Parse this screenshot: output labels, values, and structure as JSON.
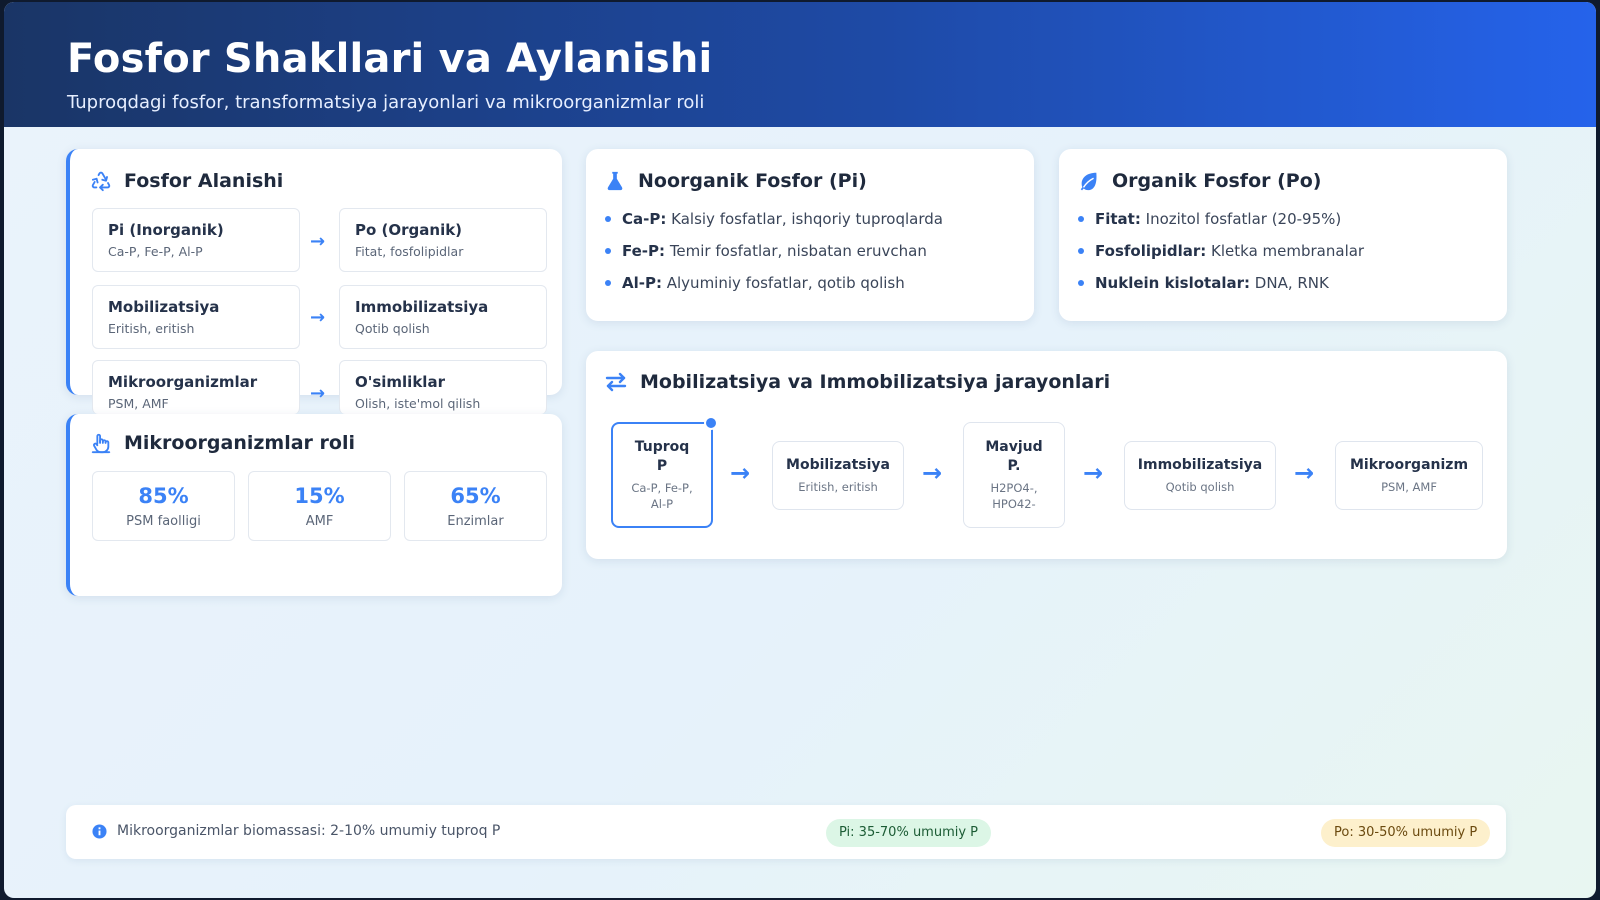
{
  "header": {
    "title": "Fosfor Shakllari va Aylanishi",
    "subtitle": "Tuproqdagi fosfor, transformatsiya jarayonlari va mikroorganizmlar roli"
  },
  "exchange": {
    "title": "Fosfor Alanishi",
    "icon": "recycle-icon",
    "rows": [
      {
        "left_title": "Pi (Inorganik)",
        "left_sub": "Ca-P, Fe-P, Al-P",
        "right_title": "Po (Organik)",
        "right_sub": "Fitat, fosfolipidlar"
      },
      {
        "left_title": "Mobilizatsiya",
        "left_sub": "Eritish, eritish",
        "right_title": "Immobilizatsiya",
        "right_sub": "Qotib qolish"
      },
      {
        "left_title": "Mikroorganizmlar",
        "left_sub": "PSM, AMF",
        "right_title": "O'simliklar",
        "right_sub": "Olish, iste'mol qilish"
      }
    ]
  },
  "microbes": {
    "title": "Mikroorganizmlar roli",
    "icon": "hand-icon",
    "stats": [
      {
        "value": "85%",
        "label": "PSM faolligi"
      },
      {
        "value": "15%",
        "label": "AMF"
      },
      {
        "value": "65%",
        "label": "Enzimlar"
      }
    ]
  },
  "inorganic": {
    "title": "Noorganik Fosfor (Pi)",
    "icon": "flask-icon",
    "items": [
      {
        "term": "Ca-P:",
        "desc": "Kalsiy fosfatlar, ishqoriy tuproqlarda"
      },
      {
        "term": "Fe-P:",
        "desc": "Temir fosfatlar, nisbatan eruvchan"
      },
      {
        "term": "Al-P:",
        "desc": "Alyuminiy fosfatlar, qotib qolish"
      }
    ]
  },
  "organic": {
    "title": "Organik Fosfor (Po)",
    "icon": "leaf-icon",
    "items": [
      {
        "term": "Fitat:",
        "desc": "Inozitol fosfatlar (20-95%)"
      },
      {
        "term": "Fosfolipidlar:",
        "desc": "Kletka membranalar"
      },
      {
        "term": "Nuklein kislotalar:",
        "desc": "DNA, RNK"
      }
    ]
  },
  "flow": {
    "title": "Mobilizatsiya va Immobilizatsiya jarayonlari",
    "icon": "exchange-arrows-icon",
    "nodes": [
      {
        "title": "Tuproq P",
        "sub": "Ca-P, Fe-P, Al-P"
      },
      {
        "title": "Mobilizatsiya",
        "sub": "Eritish, eritish"
      },
      {
        "title": "Mavjud P.",
        "sub": "H2PO4-, HPO42-"
      },
      {
        "title": "Immobilizatsiya",
        "sub": "Qotib qolish"
      },
      {
        "title": "Mikroorganizm",
        "sub": "PSM, AMF"
      }
    ]
  },
  "footer": {
    "note": "Mikroorganizmlar biomassasi: 2-10% umumiy tuproq P",
    "pi_badge": "Pi: 35-70% umumiy P",
    "po_badge": "Po: 30-50% umumiy P"
  },
  "colors": {
    "accent": "#3b82f6",
    "header_start": "#1a3566",
    "header_end": "#2563eb"
  }
}
